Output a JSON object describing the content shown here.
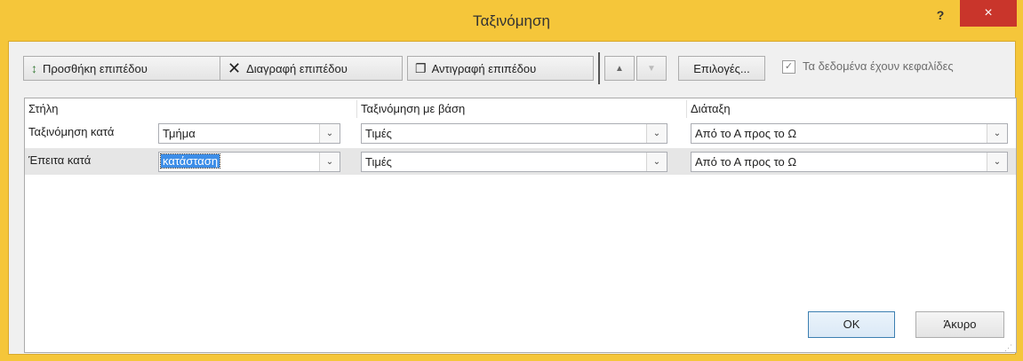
{
  "window": {
    "title": "Ταξινόμηση",
    "help": "?",
    "close": "×"
  },
  "toolbar": {
    "add_label": "Προσθήκη επιπέδου",
    "delete_label": "Διαγραφή επιπέδου",
    "copy_label": "Αντιγραφή επιπέδου",
    "options_label": "Επιλογές...",
    "headers_checked": true,
    "headers_label": "Τα δεδομένα έχουν κεφαλίδες"
  },
  "grid": {
    "headers": {
      "column": "Στήλη",
      "sort_on": "Ταξινόμηση με βάση",
      "order": "Διάταξη"
    },
    "rows": [
      {
        "label": "Ταξινόμηση κατά",
        "column": "Τμήμα",
        "sort_on": "Τιμές",
        "order": "Από το Α προς το Ω"
      },
      {
        "label": "Έπειτα κατά",
        "column": "κατάσταση",
        "sort_on": "Τιμές",
        "order": "Από το Α προς το Ω"
      }
    ]
  },
  "footer": {
    "ok": "OK",
    "cancel": "Άκυρο"
  },
  "colors": {
    "frame": "#f5c63a",
    "close": "#c9352b",
    "selection": "#3d8ee8"
  }
}
